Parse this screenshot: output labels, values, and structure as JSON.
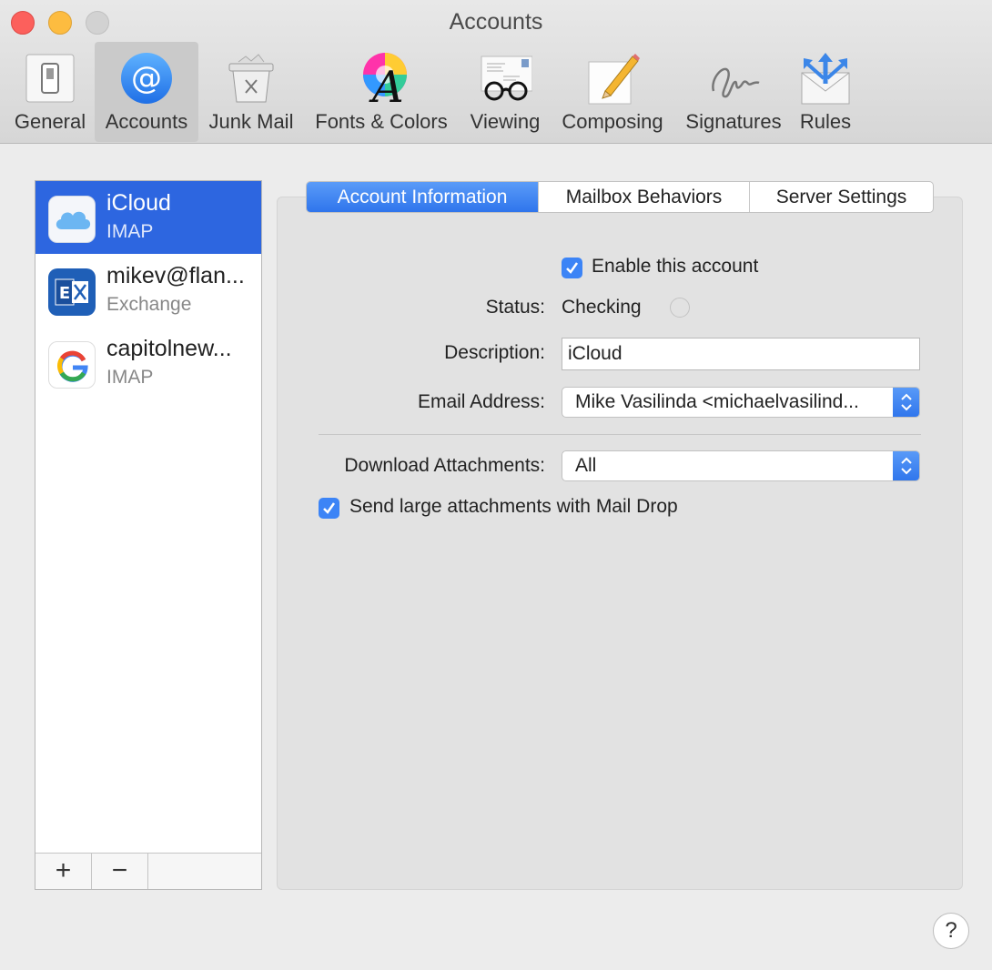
{
  "window": {
    "title": "Accounts"
  },
  "toolbar": {
    "items": [
      {
        "label": "General",
        "icon": "switch-icon"
      },
      {
        "label": "Accounts",
        "icon": "at-sign-icon",
        "selected": true
      },
      {
        "label": "Junk Mail",
        "icon": "trash-icon"
      },
      {
        "label": "Fonts & Colors",
        "icon": "font-color-wheel-icon"
      },
      {
        "label": "Viewing",
        "icon": "glasses-icon"
      },
      {
        "label": "Composing",
        "icon": "pencil-icon"
      },
      {
        "label": "Signatures",
        "icon": "signature-icon"
      },
      {
        "label": "Rules",
        "icon": "envelope-arrows-icon"
      }
    ]
  },
  "accounts": [
    {
      "name": "iCloud",
      "type": "IMAP",
      "icon": "icloud-icon",
      "selected": true
    },
    {
      "name": "mikev@flan...",
      "type": "Exchange",
      "icon": "exchange-icon"
    },
    {
      "name": "capitolnew...",
      "type": "IMAP",
      "icon": "google-icon"
    }
  ],
  "list_footer": {
    "add": "+",
    "remove": "−"
  },
  "tabs": [
    "Account Information",
    "Mailbox Behaviors",
    "Server Settings"
  ],
  "form": {
    "enable_label": "Enable this account",
    "status_label": "Status:",
    "status_value": "Checking",
    "description_label": "Description:",
    "description_value": "iCloud",
    "email_label": "Email Address:",
    "email_value": "Mike Vasilinda <michaelvasilind...",
    "download_label": "Download Attachments:",
    "download_value": "All",
    "maildrop_label": "Send large attachments with Mail Drop"
  },
  "help": "?",
  "colors": {
    "accent": "#2d66e0",
    "checkbox": "#3c84f6"
  }
}
